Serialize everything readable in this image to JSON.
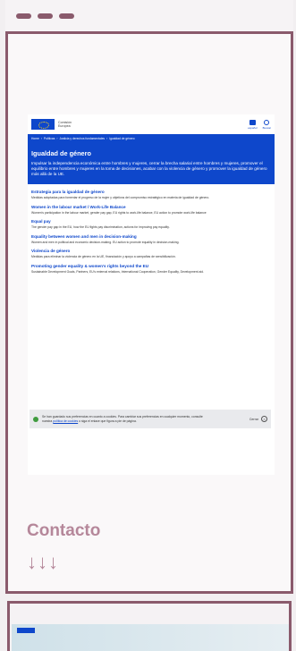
{
  "header": {
    "commission_line1": "Comisión",
    "commission_line2": "Europea",
    "language_label": "español",
    "search_label": "Buscar"
  },
  "breadcrumb": [
    "Home",
    "Políticas",
    "Justicia y derechos fundamentales",
    "Igualdad de género"
  ],
  "hero": {
    "title": "Igualdad de género",
    "description": "Impulsar la independencia económica entre hombres y mujeres, cerrar la brecha salarial entre hombres y mujeres, promover el equilibrio entre hombres y mujeres en la toma de decisiones, acabar con la violencia de género y promover la igualdad de género más allá de la UE."
  },
  "items": [
    {
      "title": "Estrategia para la igualdad de género",
      "desc": "Medidas adoptadas para fomentar el progreso de la mujer y objetivos del compromiso estratégico en materia de igualdad de género."
    },
    {
      "title": "Women in the labour market / Work-Life Balance",
      "desc": "Women's participation in the labour market, gender pay gap, EU rights to work-life balance, EU action to promote work-life balance"
    },
    {
      "title": "Equal pay",
      "desc": "The gender pay gap in the EU, how the EU fights pay discrimination, actions for improving pay equality."
    },
    {
      "title": "Equality between women and men in decision-making",
      "desc": "Women and men in political and economic decision-making. EU action to promote equality in decision-making."
    },
    {
      "title": "Violencia de género",
      "desc": "Medidas para eliminar la violencia de género en la UE, financiación y apoyo a campañas de sensibilización."
    },
    {
      "title": "Promoting gender equality & women's rights beyond the EU",
      "desc": "Sustainable Development Goals, Partners, EU's external relations, International Cooperation, Gender Equality, Development aid."
    }
  ],
  "cookie": {
    "text_before": "Se han guardado sus preferencias en cuanto a cookies. Para cambiar sus preferencias en cualquier momento, consulte nuestra",
    "link": "política de cookies",
    "text_after": "o siga el enlace que figura a pie de página.",
    "close_label": "Cerrar"
  },
  "contact": {
    "title": "Contacto",
    "arrows": "↓↓↓"
  }
}
